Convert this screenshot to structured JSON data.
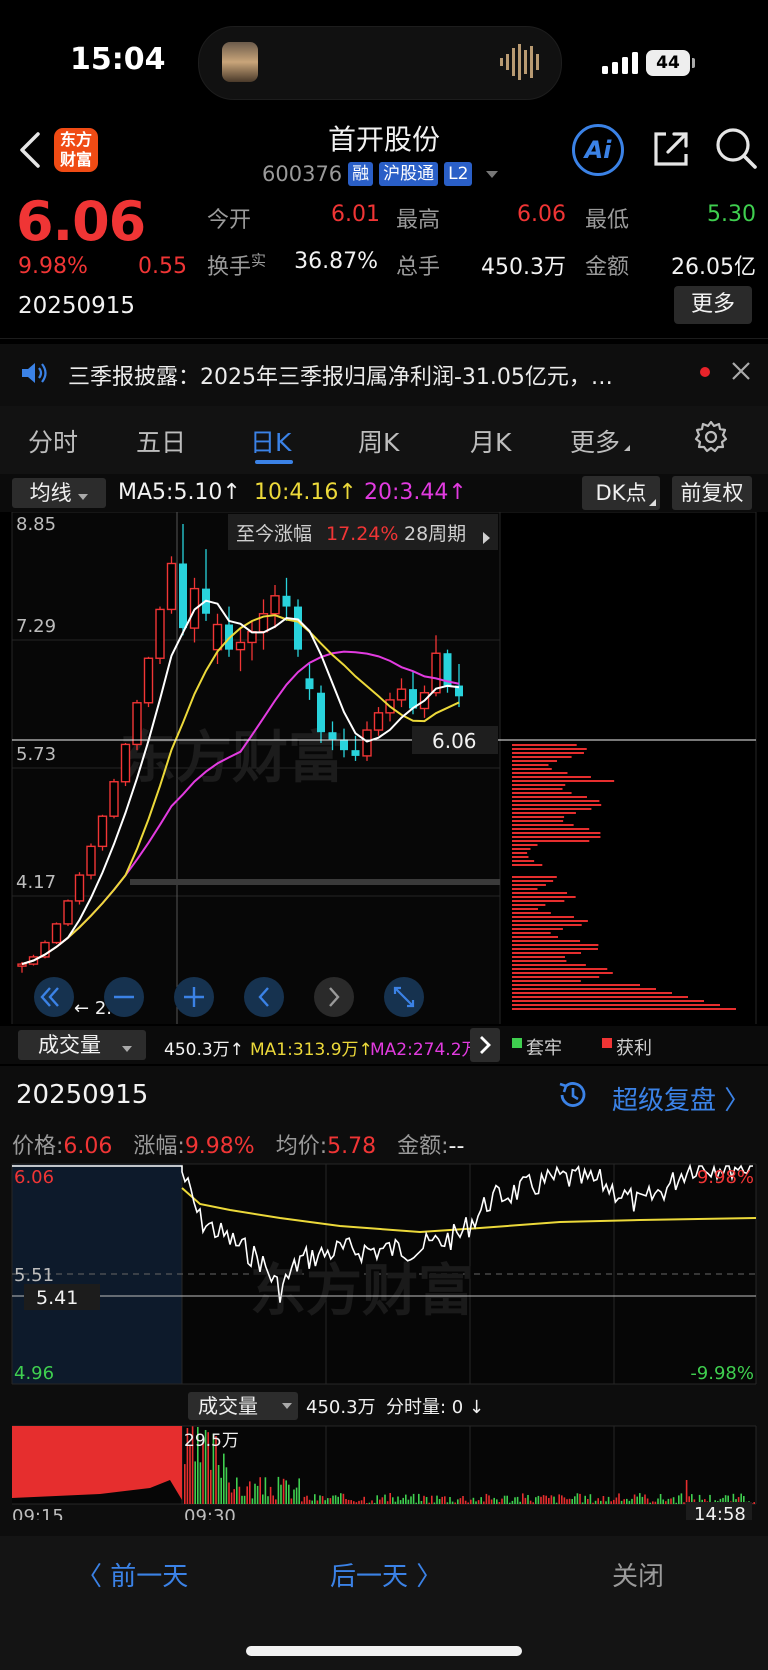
{
  "status_bar": {
    "time": "15:04",
    "battery": "44"
  },
  "header": {
    "logo_text": "东方财富",
    "stock_name": "首开股份",
    "code": "600376",
    "tags": [
      "融",
      "沪股通",
      "L2"
    ],
    "ai_label": "Ai"
  },
  "quote": {
    "price": "6.06",
    "change_pct": "9.98%",
    "change_abs": "0.55",
    "date": "20250915",
    "open_label": "今开",
    "open": "6.01",
    "high_label": "最高",
    "high": "6.06",
    "low_label": "最低",
    "low": "5.30",
    "turnover_label": "换手",
    "turnover_sup": "实",
    "turnover": "36.87%",
    "volume_label": "总手",
    "volume": "450.3万",
    "amount_label": "金额",
    "amount": "26.05亿",
    "more_label": "更多"
  },
  "news": {
    "text": "三季报披露：2025年三季报归属净利润-31.05亿元，…"
  },
  "tabs": [
    "分时",
    "五日",
    "日K",
    "周K",
    "月K",
    "更多"
  ],
  "kline_bar": {
    "ma_selector": "均线",
    "ma5": "MA5:5.10",
    "ma10": "10:4.16",
    "ma20": "20:3.44",
    "dk_label": "DK点",
    "adjust_label": "前复权"
  },
  "kchart": {
    "y_labels": [
      "8.85",
      "7.29",
      "5.73",
      "4.17"
    ],
    "min_label": "2.61",
    "last_price_label": "6.06",
    "range_label": "至今涨幅",
    "range_pct": "17.24%",
    "range_periods": "28周期"
  },
  "volume_bar": {
    "selector": "成交量",
    "vol": "450.3万",
    "ma1": "MA1:313.9万",
    "ma2": "MA2:274.2万",
    "legend_trapped": "套牢",
    "legend_profit": "获利"
  },
  "lower": {
    "date": "20250915",
    "replay_label": "超级复盘",
    "price_label": "价格:",
    "price": "6.06",
    "pct_label": "涨幅:",
    "pct": "9.98%",
    "avg_label": "均价:",
    "avg": "5.78",
    "amount_label": "金额:",
    "amount": "--",
    "y_top": "6.06",
    "y_mid": "5.51",
    "y_bottom": "4.96",
    "pct_top": "9.98%",
    "pct_bottom": "-9.98%",
    "hover_value": "5.41",
    "vol_selector": "成交量",
    "vol_total": "450.3万",
    "vol_minute": "分时量: 0",
    "vol_peak": "29.5万",
    "time_start": "09:15",
    "time_open": "09:30",
    "time_now": "14:58"
  },
  "footer": {
    "prev": "前一天",
    "next": "后一天",
    "close": "关闭"
  },
  "colors": {
    "up": "#f03535",
    "down": "#29d3dc",
    "accent": "#3b82e6",
    "ma5": "#ffffff",
    "ma10": "#ecd93a",
    "ma20": "#e23be0",
    "green": "#3fcf4f"
  }
}
